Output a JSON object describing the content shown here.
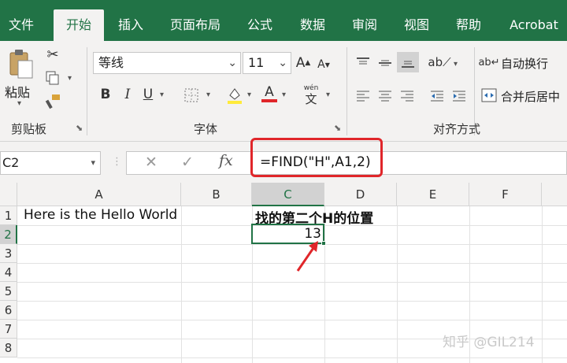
{
  "tabs": [
    {
      "label": "文件"
    },
    {
      "label": "开始"
    },
    {
      "label": "插入"
    },
    {
      "label": "页面布局"
    },
    {
      "label": "公式"
    },
    {
      "label": "数据"
    },
    {
      "label": "审阅"
    },
    {
      "label": "视图"
    },
    {
      "label": "帮助"
    },
    {
      "label": "Acrobat"
    }
  ],
  "active_tab": "开始",
  "clipboard": {
    "paste_label": "粘贴",
    "group_label": "剪贴板"
  },
  "font": {
    "name": "等线",
    "size": "11",
    "group_label": "字体",
    "bold": "B",
    "italic": "I",
    "underline": "U",
    "phonetic_top": "wén",
    "phonetic_bottom": "文",
    "font_color_glyph": "A",
    "fill_color": "#ffeb3b",
    "font_color": "#e0262a"
  },
  "alignment": {
    "wrap_label": "自动换行",
    "merge_label": "合并后居中",
    "group_label": "对齐方式"
  },
  "namebox": {
    "value": "C2"
  },
  "formula_bar": {
    "fx": "fx",
    "formula": "=FIND(\"H\",A1,2)"
  },
  "columns": [
    "A",
    "B",
    "C",
    "D",
    "E",
    "F"
  ],
  "rows": [
    "1",
    "2",
    "3",
    "4",
    "5",
    "6",
    "7",
    "8"
  ],
  "cells": {
    "A1": "Here is the Hello World",
    "C1": "找的第二个H的位置",
    "C2": "13"
  },
  "selected_cell": "C2",
  "accent": "#217346",
  "highlight": "#e0262a",
  "watermark": "知乎 @GIL214"
}
